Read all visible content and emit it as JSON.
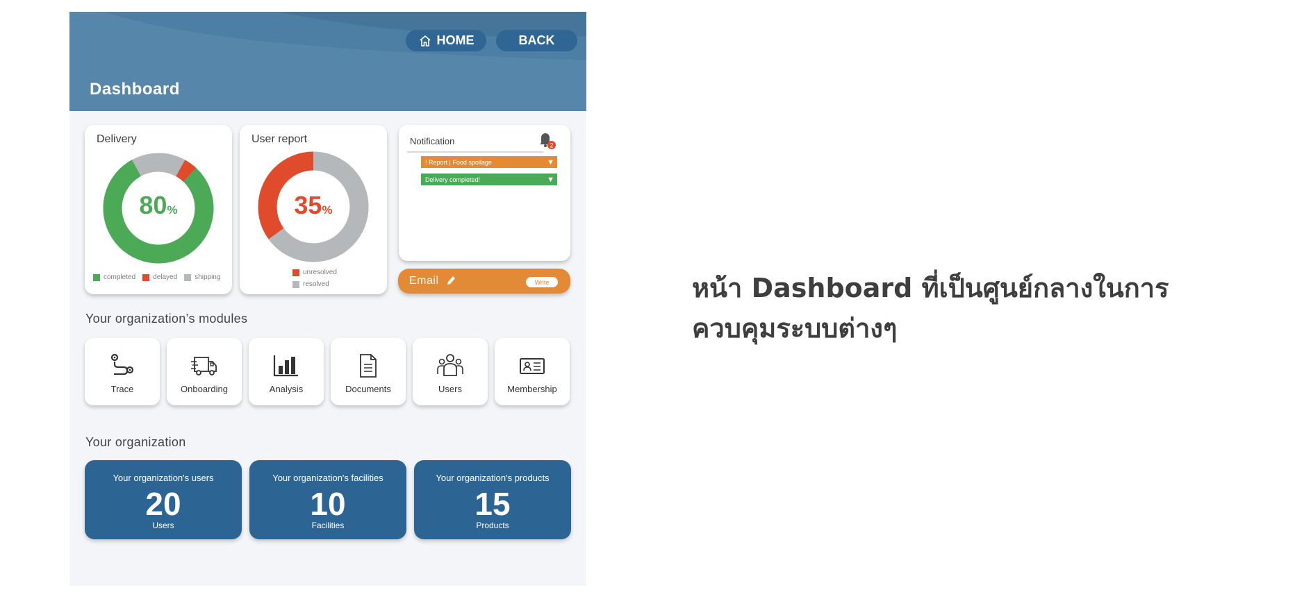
{
  "header": {
    "title": "Dashboard",
    "home_label": "HOME",
    "back_label": "BACK"
  },
  "delivery": {
    "title": "Delivery",
    "value": "80",
    "unit": "%",
    "segments": [
      {
        "name": "completed",
        "percent": 80,
        "color": "#4caa57"
      },
      {
        "name": "delayed",
        "percent": 4,
        "color": "#e04b2b"
      },
      {
        "name": "shipping",
        "percent": 8,
        "color": "#b5b8bb"
      }
    ],
    "legend": [
      "completed",
      "delayed",
      "shipping"
    ]
  },
  "user_report": {
    "title": "User report",
    "value": "35",
    "unit": "%",
    "segments": [
      {
        "name": "unresolved",
        "percent": 35,
        "color": "#e04b2b"
      },
      {
        "name": "resolved",
        "percent": 65,
        "color": "#b5b8bb"
      }
    ],
    "legend": [
      "unresolved",
      "resolved"
    ]
  },
  "notification": {
    "title": "Notification",
    "badge_count": "2",
    "items": [
      {
        "text": "! Report | Food spoilage",
        "color": "#e38a36"
      },
      {
        "text": "Delivery completed!",
        "color": "#4caa57"
      }
    ]
  },
  "email": {
    "label": "Email",
    "write_label": "Write"
  },
  "modules": {
    "title": "Your organization’s modules",
    "items": [
      {
        "label": "Trace",
        "icon": "route-icon"
      },
      {
        "label": "Onboarding",
        "icon": "truck-icon"
      },
      {
        "label": "Analysis",
        "icon": "bar-chart-icon"
      },
      {
        "label": "Documents",
        "icon": "document-icon"
      },
      {
        "label": "Users",
        "icon": "users-icon"
      },
      {
        "label": "Membership",
        "icon": "id-card-icon"
      }
    ]
  },
  "organization": {
    "title": "Your organization",
    "stats": [
      {
        "title": "Your organization's users",
        "value": "20",
        "unit": "Users"
      },
      {
        "title": "Your organization's facilities",
        "value": "10",
        "unit": "Facilities"
      },
      {
        "title": "Your organization's products",
        "value": "15",
        "unit": "Products"
      }
    ]
  },
  "caption": {
    "line1": "หน้า Dashboard ที่เป็นศูนย์กลางในการ",
    "line2": "ควบคุมระบบต่างๆ"
  },
  "colors": {
    "header": "#5687ab",
    "primary": "#2c6594",
    "green": "#4caa57",
    "red": "#e04b2b",
    "orange": "#e38a36",
    "gray": "#b5b8bb"
  }
}
